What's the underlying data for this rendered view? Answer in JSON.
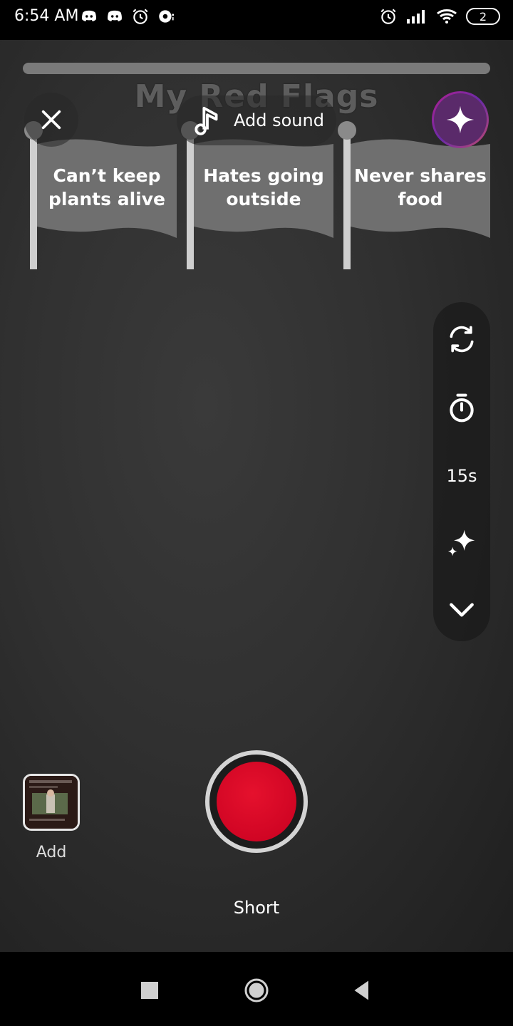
{
  "status_bar": {
    "time": "6:54 AM",
    "battery": "2",
    "left_icons": [
      "discord-icon",
      "discord-icon",
      "alarm-icon",
      "sync-icon"
    ],
    "right_icons": [
      "alarm-icon",
      "signal-icon",
      "wifi-icon",
      "battery-icon"
    ]
  },
  "camera": {
    "overlay_title": "My Red Flags",
    "add_sound_label": "Add sound",
    "flags": [
      {
        "text": "Can’t keep plants alive"
      },
      {
        "text": "Hates going outside"
      },
      {
        "text": "Never shares food"
      }
    ],
    "toolbar": {
      "flip_icon": "flip-camera-icon",
      "timer_icon": "timer-icon",
      "duration_label": "15s",
      "effects_icon": "sparkle-icon",
      "expand_icon": "chevron-down-icon"
    },
    "record_button_color": "#d7001f",
    "progress_color": "#7a7a7a"
  },
  "bottom": {
    "gallery_label": "Add",
    "mode_label": "Short"
  },
  "nav_bar": {
    "icons": [
      "recent-apps-icon",
      "home-icon",
      "back-icon"
    ]
  }
}
